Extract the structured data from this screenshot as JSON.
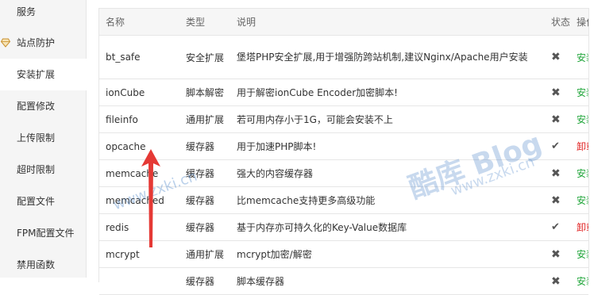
{
  "sidebar": {
    "items": [
      {
        "label": "服务"
      },
      {
        "label": "站点防护"
      },
      {
        "label": "安装扩展"
      },
      {
        "label": "配置修改"
      },
      {
        "label": "上传限制"
      },
      {
        "label": "超时限制"
      },
      {
        "label": "配置文件"
      },
      {
        "label": "FPM配置文件"
      },
      {
        "label": "禁用函数"
      }
    ],
    "active_index": 2
  },
  "table": {
    "headers": {
      "name": "名称",
      "type": "类型",
      "desc": "说明",
      "status": "状态",
      "op": "操作"
    },
    "rows": [
      {
        "name": "bt_safe",
        "type": "安全扩展",
        "desc": "堡塔PHP安全扩展,用于增强防跨站机制,建议Nginx/Apache用户安装",
        "status": "not-installed",
        "op": "安装"
      },
      {
        "name": "ionCube",
        "type": "脚本解密",
        "desc": "用于解密ionCube Encoder加密脚本!",
        "status": "not-installed",
        "op": "安装"
      },
      {
        "name": "fileinfo",
        "type": "通用扩展",
        "desc": "若可用内存小于1G，可能会安装不上",
        "status": "not-installed",
        "op": "安装"
      },
      {
        "name": "opcache",
        "type": "缓存器",
        "desc": "用于加速PHP脚本!",
        "status": "installed",
        "op": "卸载"
      },
      {
        "name": "memcache",
        "type": "缓存器",
        "desc": "强大的内容缓存器",
        "status": "not-installed",
        "op": "安装"
      },
      {
        "name": "memcached",
        "type": "缓存器",
        "desc": "比memcache支持更多高级功能",
        "status": "not-installed",
        "op": "安装"
      },
      {
        "name": "redis",
        "type": "缓存器",
        "desc": "基于内存亦可持久化的Key-Value数据库",
        "status": "installed",
        "op": "卸载"
      },
      {
        "name": "mcrypt",
        "type": "通用扩展",
        "desc": "mcrypt加密/解密",
        "status": "not-installed",
        "op": "安装"
      },
      {
        "name": "",
        "type": "缓存器",
        "desc": "脚本缓存器",
        "status": "not-installed",
        "op": "安装"
      }
    ]
  },
  "watermark": {
    "big": "酷库 Blog",
    "small": "www.zxki.cn"
  },
  "colors": {
    "install": "#20a53a",
    "uninstall": "#e01e1e",
    "arrow": "#e53935"
  }
}
